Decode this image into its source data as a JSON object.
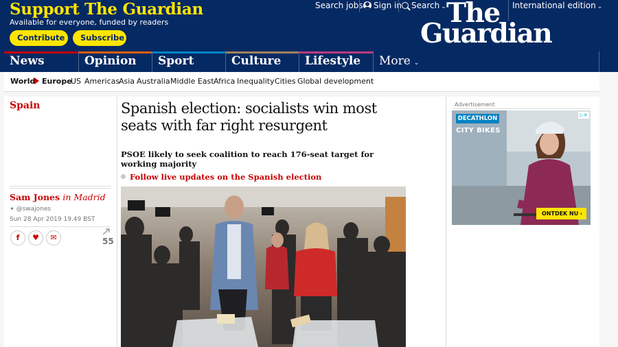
{
  "header": {
    "support_title": "Support The Guardian",
    "support_subtitle": "Available for everyone, funded by readers",
    "contribute_label": "Contribute",
    "subscribe_label": "Subscribe",
    "search_jobs": "Search jobs",
    "sign_in": "Sign in",
    "search": "Search",
    "edition": "International edition",
    "logo_line1": "The",
    "logo_line2": "Guardian"
  },
  "nav": {
    "pillars": [
      {
        "label": "News",
        "color": "#c70000"
      },
      {
        "label": "Opinion",
        "color": "#e05e00"
      },
      {
        "label": "Sport",
        "color": "#0084c6"
      },
      {
        "label": "Culture",
        "color": "#a1845c"
      },
      {
        "label": "Lifestyle",
        "color": "#bb3b80"
      },
      {
        "label": "More"
      }
    ]
  },
  "subnav": {
    "items": [
      "World",
      "Europe",
      "US",
      "Americas",
      "Asia",
      "Australia",
      "Middle East",
      "Africa",
      "Inequality",
      "Cities",
      "Global development"
    ]
  },
  "article": {
    "section": "Spain",
    "headline": "Spanish election: socialists win most seats with far right resurgent",
    "standfirst": "PSOE likely to seek coalition to reach 176-seat target for working majority",
    "live_link": "Follow live updates on the Spanish election",
    "author": "Sam Jones",
    "author_location": "in Madrid",
    "twitter": "@swajones",
    "date": "Sun 28 Apr 2019 19.49 BST",
    "share_count": "55"
  },
  "ad": {
    "label": "Advertisement",
    "brand": "DECATHLON",
    "tagline": "CITY BIKES",
    "cta": "ONTDEK NU"
  }
}
